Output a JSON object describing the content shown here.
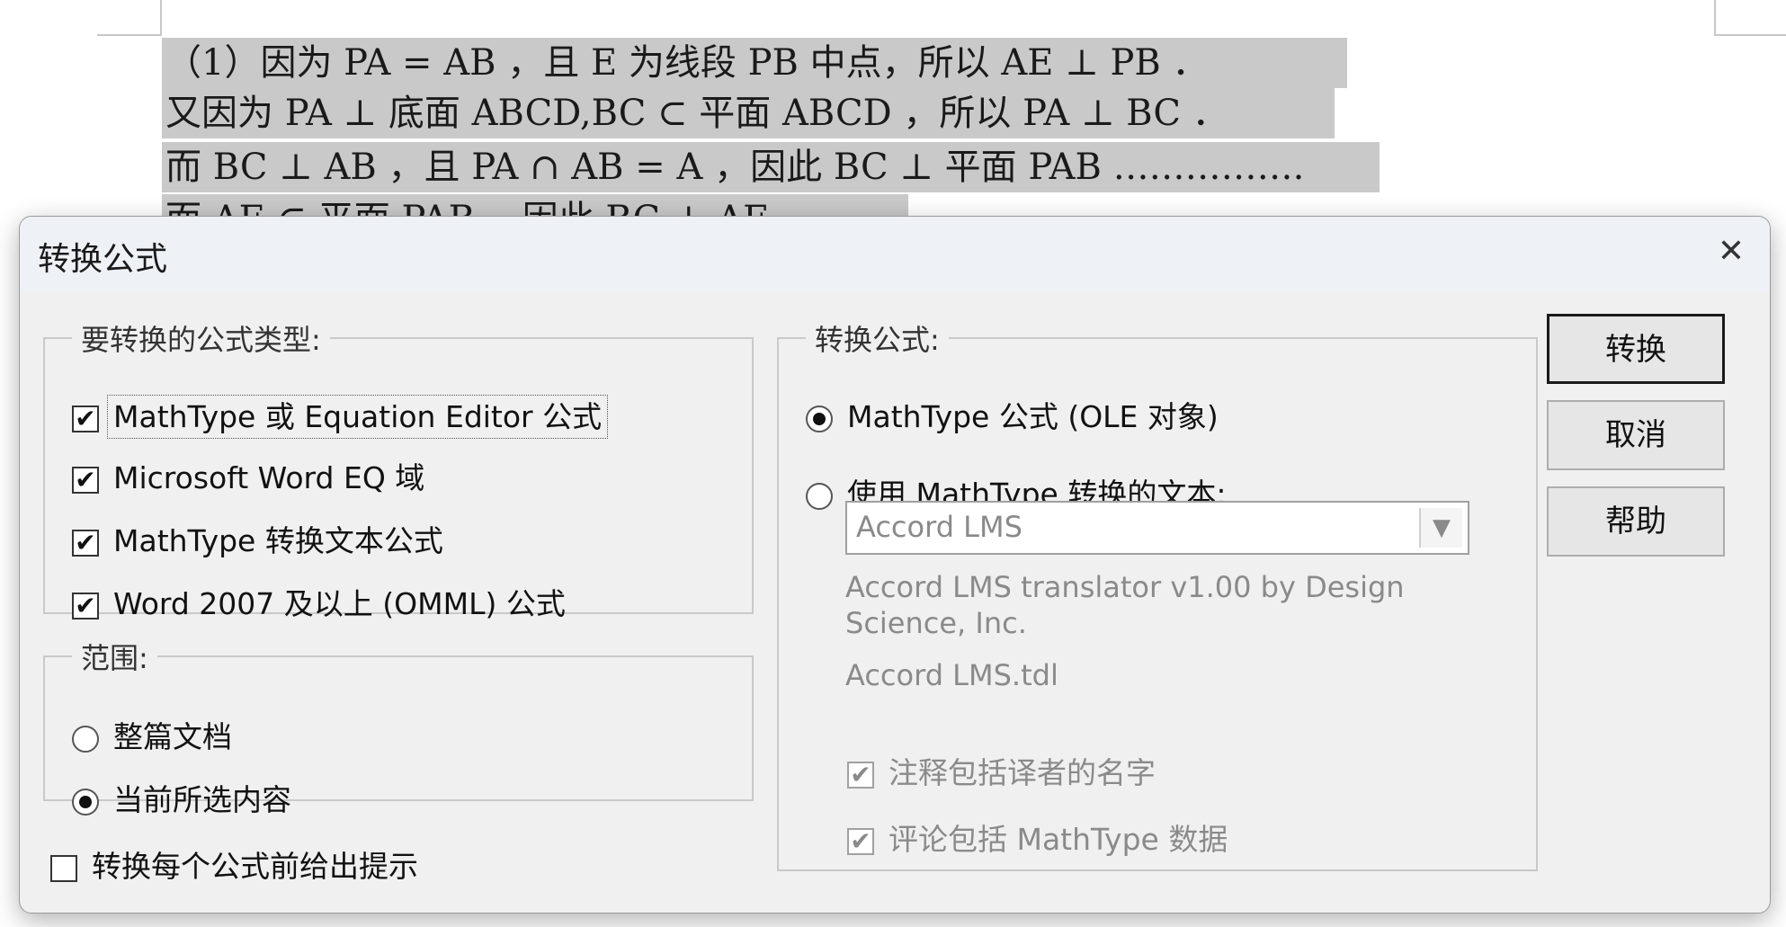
{
  "document": {
    "line1": "（1）因为 PA = AB ，且 E 为线段 PB 中点，所以 AE ⊥ PB ．",
    "line2": "又因为 PA ⊥ 底面 ABCD,BC ⊂ 平面 ABCD ，所以 PA ⊥ BC ．",
    "line3": "而 BC ⊥ AB ，且 PA ∩ AB = A ，因此 BC ⊥ 平面 PAB …………….",
    "line4": "而 AE ⊂ 平面 PAB ，因此 BC ⊥ AE ."
  },
  "dialog": {
    "title": "转换公式",
    "close_icon": "close-icon",
    "types_group": {
      "legend": "要转换的公式类型:",
      "items": [
        {
          "label": "MathType 或 Equation Editor 公式",
          "checked": true
        },
        {
          "label": "Microsoft Word EQ 域",
          "checked": true
        },
        {
          "label": "MathType 转换文本公式",
          "checked": true
        },
        {
          "label": "Word 2007 及以上 (OMML) 公式",
          "checked": true
        }
      ]
    },
    "range_group": {
      "legend": "范围:",
      "options": [
        {
          "label": "整篇文档",
          "selected": false
        },
        {
          "label": "当前所选内容",
          "selected": true
        }
      ]
    },
    "prompt_checkbox": {
      "label": "转换每个公式前给出提示",
      "checked": false
    },
    "convert_group": {
      "legend": "转换公式:",
      "options": [
        {
          "label": "MathType 公式 (OLE 对象)",
          "selected": true
        },
        {
          "label": "使用 MathType 转换的文本:",
          "selected": false
        }
      ],
      "translator_select": "Accord LMS",
      "translator_desc": "Accord LMS translator v1.00 by Design Science, Inc.",
      "translator_file": "Accord LMS.tdl",
      "sub_options": [
        {
          "label": "注释包括译者的名字",
          "checked": true
        },
        {
          "label": "评论包括 MathType 数据",
          "checked": true
        }
      ]
    },
    "buttons": {
      "convert": "转换",
      "cancel": "取消",
      "help": "帮助"
    }
  }
}
